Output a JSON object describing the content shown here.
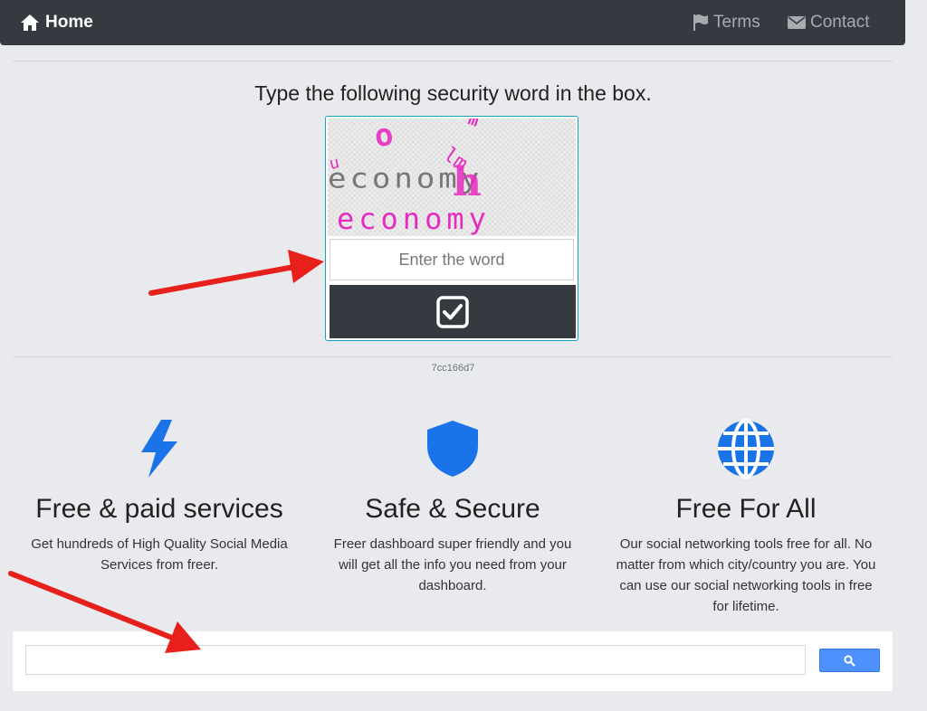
{
  "navbar": {
    "home_label": "Home",
    "terms_label": "Terms",
    "contact_label": "Contact"
  },
  "captcha": {
    "title": "Type the following security word in the box.",
    "image_word": "economy",
    "input_placeholder": "Enter the word",
    "input_value": "",
    "submit_icon": "check-square-icon",
    "code": "7cc166d7"
  },
  "features": [
    {
      "icon": "bolt-icon",
      "title": "Free & paid services",
      "description": "Get hundreds of High Quality Social Media Services from freer."
    },
    {
      "icon": "shield-icon",
      "title": "Safe & Secure",
      "description": "Freer dashboard super friendly and you will get all the info you need from your dashboard."
    },
    {
      "icon": "globe-icon",
      "title": "Free For All",
      "description": "Our social networking tools free for all. No matter from which city/country you are. You can use our social networking tools in free for lifetime."
    }
  ],
  "search": {
    "input_value": "",
    "button_icon": "search-icon"
  },
  "colors": {
    "navbar_bg": "#343a40",
    "page_bg": "#e9eaed",
    "accent_blue": "#1a73e8",
    "captcha_border": "#17a2b8",
    "search_button": "#4d90fe",
    "annotation_arrow": "#e8201c"
  }
}
